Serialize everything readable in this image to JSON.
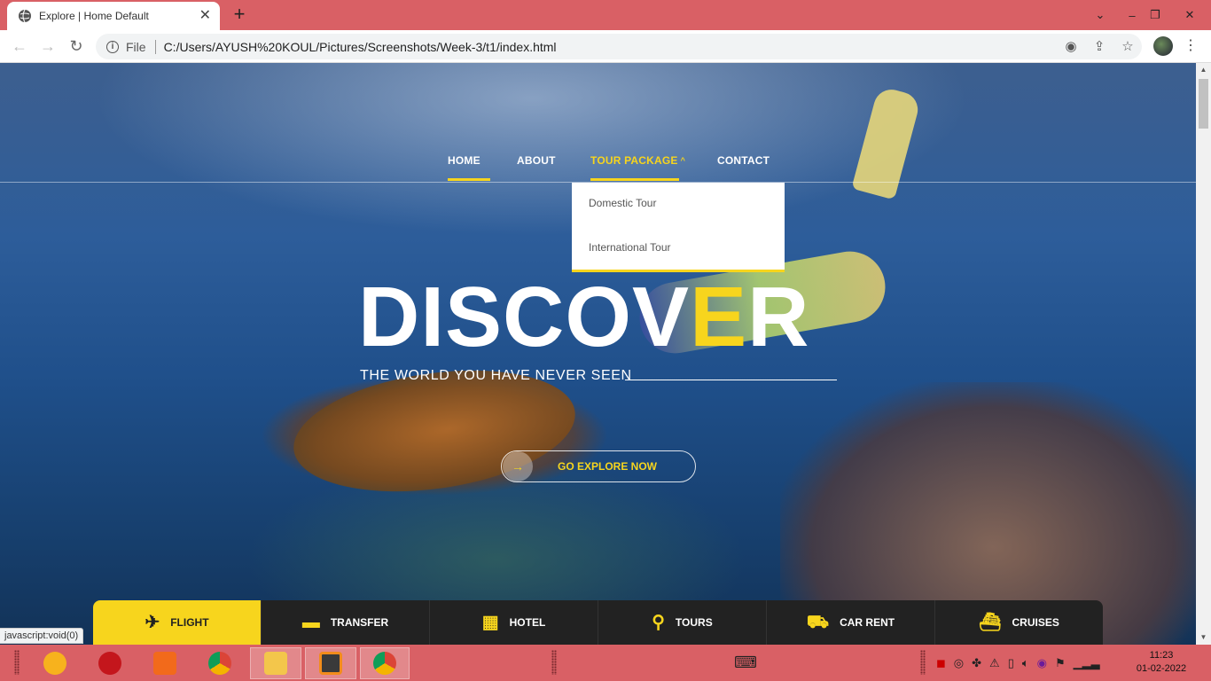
{
  "browser": {
    "tab_title": "Explore | Home Default",
    "tab_close": "✕",
    "new_tab": "+",
    "file_label": "File",
    "url": "C:/Users/AYUSH%20KOUL/Pictures/Screenshots/Week-3/t1/index.html",
    "status_tip": "javascript:void(0)"
  },
  "nav": {
    "items": [
      "HOME",
      "ABOUT",
      "TOUR PACKAGE",
      "CONTACT"
    ],
    "caret": "^",
    "dropdown": [
      "Domestic Tour",
      "International Tour"
    ]
  },
  "hero": {
    "title_a": "DISCOV",
    "title_b": "E",
    "title_c": "R",
    "subtitle": "THE WORLD YOU HAVE NEVER SEEN",
    "button": "GO EXPLORE NOW",
    "button_arrow": "→"
  },
  "services": [
    {
      "label": "FLIGHT",
      "icon": "airplane-icon",
      "glyph": "✈"
    },
    {
      "label": "TRANSFER",
      "icon": "car-icon",
      "glyph": "▬"
    },
    {
      "label": "HOTEL",
      "icon": "hotel-icon",
      "glyph": "▦"
    },
    {
      "label": "TOURS",
      "icon": "hiker-icon",
      "glyph": "⚲"
    },
    {
      "label": "CAR RENT",
      "icon": "taxi-icon",
      "glyph": "⛟"
    },
    {
      "label": "CRUISES",
      "icon": "ship-icon",
      "glyph": "⛴"
    }
  ],
  "taskbar": {
    "time": "11:23",
    "date": "01-02-2022"
  },
  "colors": {
    "accent": "#f7d51d",
    "chrome": "#d96065"
  }
}
